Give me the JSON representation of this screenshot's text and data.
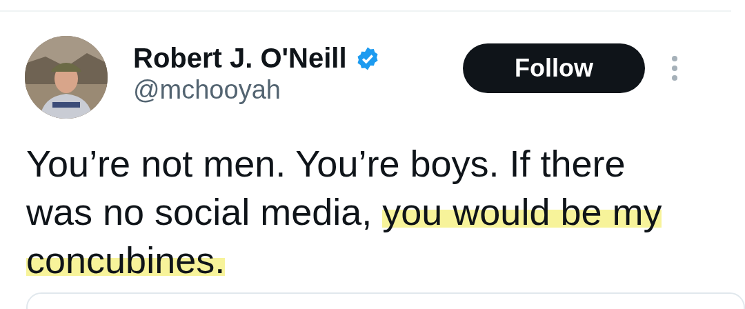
{
  "author": {
    "name": "Robert J. O'Neill",
    "verified": true,
    "handle": "@mchooyah"
  },
  "follow_button": {
    "label": "Follow"
  },
  "tweet": {
    "segments": [
      {
        "text": "You’re not men. You’re boys. If there was no social media, ",
        "highlighted": false
      },
      {
        "text": "you would be my concubines.",
        "highlighted": true
      }
    ]
  }
}
